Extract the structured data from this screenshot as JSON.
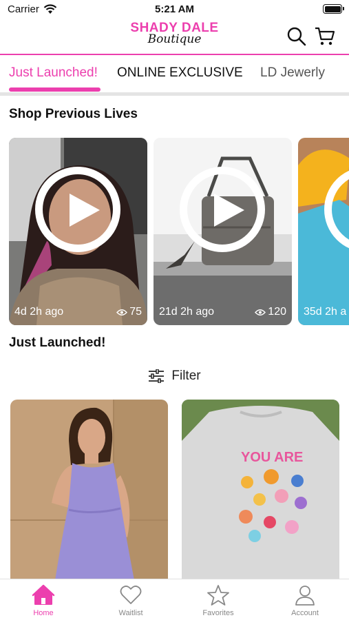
{
  "status": {
    "carrier": "Carrier",
    "time": "5:21 AM"
  },
  "brand": {
    "line1": "SHADY DALE",
    "line2": "Boutique",
    "accent": "#ec3fae"
  },
  "header_icons": [
    "search-icon",
    "cart-icon"
  ],
  "tabs": [
    {
      "label": "Just Launched!",
      "active": true
    },
    {
      "label": "ONLINE EXCLUSIVE",
      "active": false
    },
    {
      "label": "LD Jewerly",
      "active": false
    }
  ],
  "previous_lives": {
    "title": "Shop Previous Lives",
    "items": [
      {
        "age": "4d 2h ago",
        "views": "75"
      },
      {
        "age": "21d 2h ago",
        "views": "120"
      },
      {
        "age": "35d 2h a",
        "views": ""
      }
    ]
  },
  "just_launched": {
    "title": "Just Launched!",
    "filter_label": "Filter"
  },
  "sweatshirt_print": "YOU ARE",
  "bottom_nav": [
    {
      "label": "Home",
      "icon": "home-icon",
      "active": true
    },
    {
      "label": "Waitlist",
      "icon": "heart-icon",
      "active": false
    },
    {
      "label": "Favorites",
      "icon": "star-icon",
      "active": false
    },
    {
      "label": "Account",
      "icon": "account-icon",
      "active": false
    }
  ]
}
